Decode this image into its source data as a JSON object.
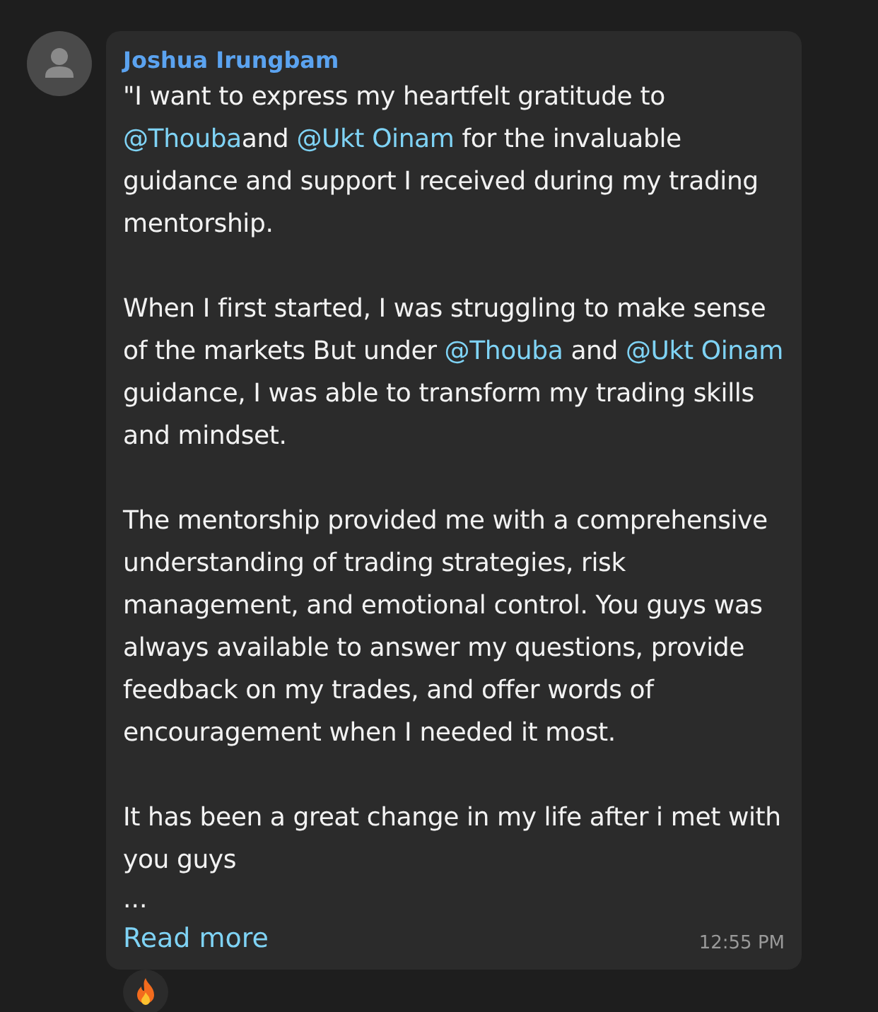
{
  "message": {
    "sender": "Joshua Irungbam",
    "paragraphs": [
      [
        {
          "kind": "text",
          "text": "\"I want to express my heartfelt gratitude to "
        },
        {
          "kind": "mention",
          "text": "@Thouba"
        },
        {
          "kind": "text",
          "text": "and "
        },
        {
          "kind": "mention",
          "text": "@Ukt Oinam"
        },
        {
          "kind": "text",
          "text": " for the invaluable guidance and support I received during my trading mentorship."
        }
      ],
      [
        {
          "kind": "text",
          "text": "When I first started, I was struggling to make sense of the markets But under "
        },
        {
          "kind": "mention",
          "text": "@Thouba"
        },
        {
          "kind": "text",
          "text": " and "
        },
        {
          "kind": "mention",
          "text": "@Ukt Oinam"
        },
        {
          "kind": "text",
          "text": " guidance, I was able to transform my trading skills and mindset."
        }
      ],
      [
        {
          "kind": "text",
          "text": "The mentorship provided me with a comprehensive understanding of trading strategies, risk management, and emotional control. You guys was always available to answer my questions, provide feedback on my trades, and offer words of encouragement when I needed it most."
        }
      ],
      [
        {
          "kind": "text",
          "text": "It has been a great change in my life after i met with you guys"
        }
      ]
    ],
    "ellipsis": "...",
    "read_more": "Read more",
    "time": "12:55 PM"
  }
}
